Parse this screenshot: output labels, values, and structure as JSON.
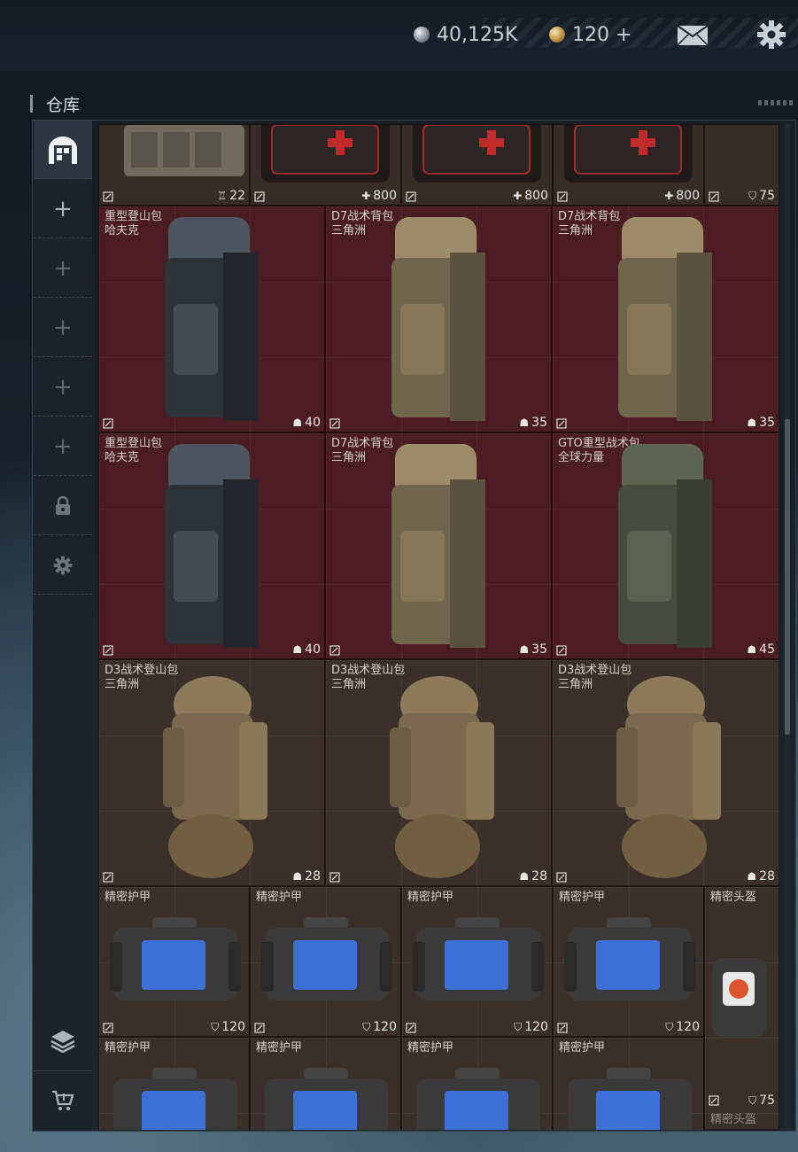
{
  "currency": {
    "silver_amount": "40,125K",
    "gold_amount": "120 +"
  },
  "warehouse": {
    "title": "仓库"
  },
  "sidebar": {
    "items": [
      {
        "icon": "warehouse-icon",
        "active": true
      },
      {
        "icon": "plus-icon",
        "label": "+"
      },
      {
        "icon": "plus-icon",
        "label": "+"
      },
      {
        "icon": "plus-icon",
        "label": "+"
      },
      {
        "icon": "plus-icon",
        "label": "+"
      },
      {
        "icon": "plus-icon",
        "label": "+"
      },
      {
        "icon": "lock-icon"
      },
      {
        "icon": "gear-icon"
      }
    ],
    "bottom": [
      {
        "icon": "layers-icon"
      },
      {
        "icon": "cart-icon"
      }
    ]
  },
  "grid": {
    "row0": [
      {
        "stat": "22",
        "stat_icon": "ammo-icon"
      },
      {
        "stat": "800",
        "stat_icon": "plus-icon"
      },
      {
        "stat": "800",
        "stat_icon": "plus-icon"
      },
      {
        "stat": "800",
        "stat_icon": "plus-icon"
      },
      {
        "stat": "75",
        "stat_icon": "shield-icon"
      }
    ],
    "row1": [
      {
        "name": "重型登山包",
        "sub": "哈夫克",
        "stat": "40"
      },
      {
        "name": "D7战术背包",
        "sub": "三角洲",
        "stat": "35"
      },
      {
        "name": "D7战术背包",
        "sub": "三角洲",
        "stat": "35"
      }
    ],
    "row2": [
      {
        "name": "重型登山包",
        "sub": "哈夫克",
        "stat": "40"
      },
      {
        "name": "D7战术背包",
        "sub": "三角洲",
        "stat": "35"
      },
      {
        "name": "GTO重型战术包",
        "sub": "全球力量",
        "stat": "45"
      }
    ],
    "row3": [
      {
        "name": "D3战术登山包",
        "sub": "三角洲",
        "stat": "28"
      },
      {
        "name": "D3战术登山包",
        "sub": "三角洲",
        "stat": "28"
      },
      {
        "name": "D3战术登山包",
        "sub": "三角洲",
        "stat": "28"
      }
    ],
    "row4": [
      {
        "name": "精密护甲",
        "stat": "120"
      },
      {
        "name": "精密护甲",
        "stat": "120"
      },
      {
        "name": "精密护甲",
        "stat": "120"
      },
      {
        "name": "精密护甲",
        "stat": "120"
      },
      {
        "name": "精密头盔"
      }
    ],
    "row5": [
      {
        "name": "精密护甲"
      },
      {
        "name": "精密护甲"
      },
      {
        "name": "精密护甲"
      },
      {
        "name": "精密护甲"
      },
      {
        "stat": "75",
        "footer": "精密头盔"
      }
    ]
  },
  "colors": {
    "red_slot": "#4a1d22",
    "brown_slot": "#3a3029",
    "accent_text": "#d6d0c8"
  }
}
